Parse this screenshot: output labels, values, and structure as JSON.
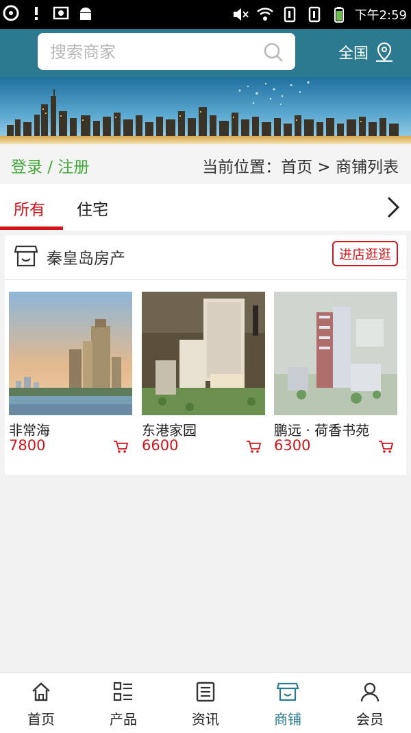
{
  "status_bar": {
    "time": "下午2:59"
  },
  "header": {
    "search_placeholder": "搜索商家",
    "region_label": "全国"
  },
  "breadcrumb_bar": {
    "login_label": "登录 / 注册",
    "path_label": "当前位置：首页 > 商铺列表"
  },
  "tabs": [
    {
      "label": "所有",
      "active": true
    },
    {
      "label": "住宅",
      "active": false
    }
  ],
  "shop": {
    "name": "秦皇岛房产",
    "visit_label": "进店逛逛",
    "items": [
      {
        "name": "非常海",
        "price": "7800"
      },
      {
        "name": "东港家园",
        "price": "6600"
      },
      {
        "name": "鹏远 · 荷香书苑",
        "price": "6300"
      }
    ]
  },
  "bottom_nav": [
    {
      "label": "首页",
      "icon": "home-icon",
      "active": false
    },
    {
      "label": "产品",
      "icon": "grid-list-icon",
      "active": false
    },
    {
      "label": "资讯",
      "icon": "news-icon",
      "active": false
    },
    {
      "label": "商铺",
      "icon": "store-icon",
      "active": true
    },
    {
      "label": "会员",
      "icon": "user-icon",
      "active": false
    }
  ],
  "colors": {
    "primary": "#2c7a90",
    "accent_red": "#d3141c",
    "login_green": "#43a83a"
  }
}
